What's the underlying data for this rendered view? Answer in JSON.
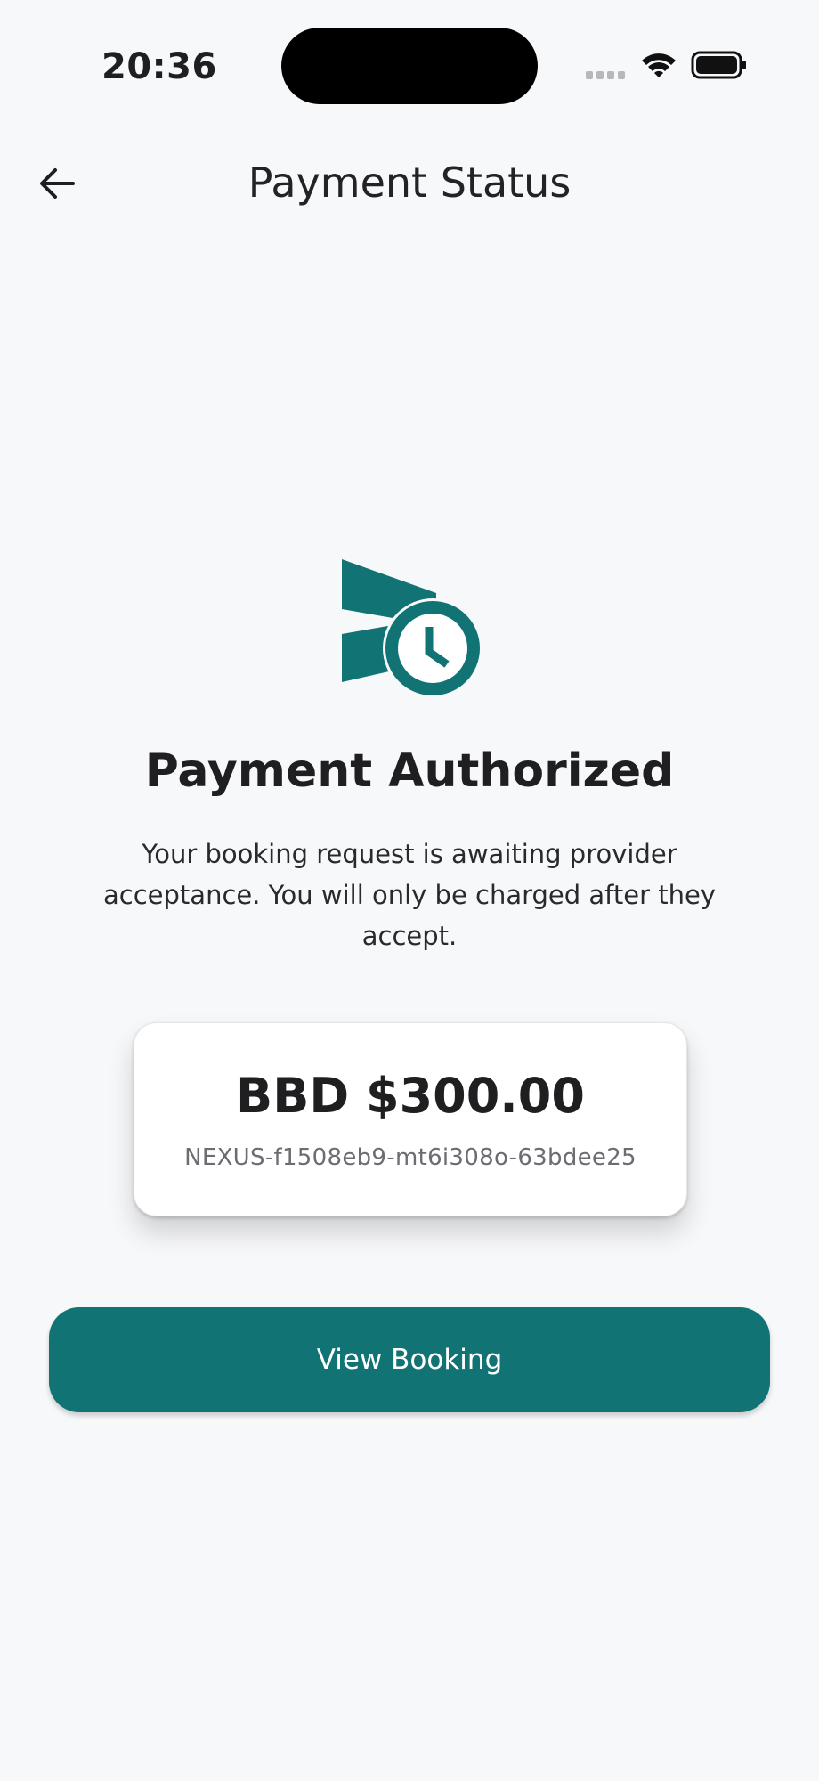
{
  "status_bar": {
    "time": "20:36"
  },
  "header": {
    "title": "Payment Status",
    "back_icon": "arrow-left-icon"
  },
  "status": {
    "icon": "send-pending-clock-icon",
    "icon_color": "#117374",
    "headline": "Payment Authorized",
    "description": "Your booking request is awaiting provider acceptance. You will only be charged after they accept."
  },
  "payment": {
    "amount": "BBD $300.00",
    "reference": "NEXUS-f1508eb9-mt6i308o-63bdee25"
  },
  "actions": {
    "view_booking_label": "View Booking",
    "button_color": "#117374"
  }
}
